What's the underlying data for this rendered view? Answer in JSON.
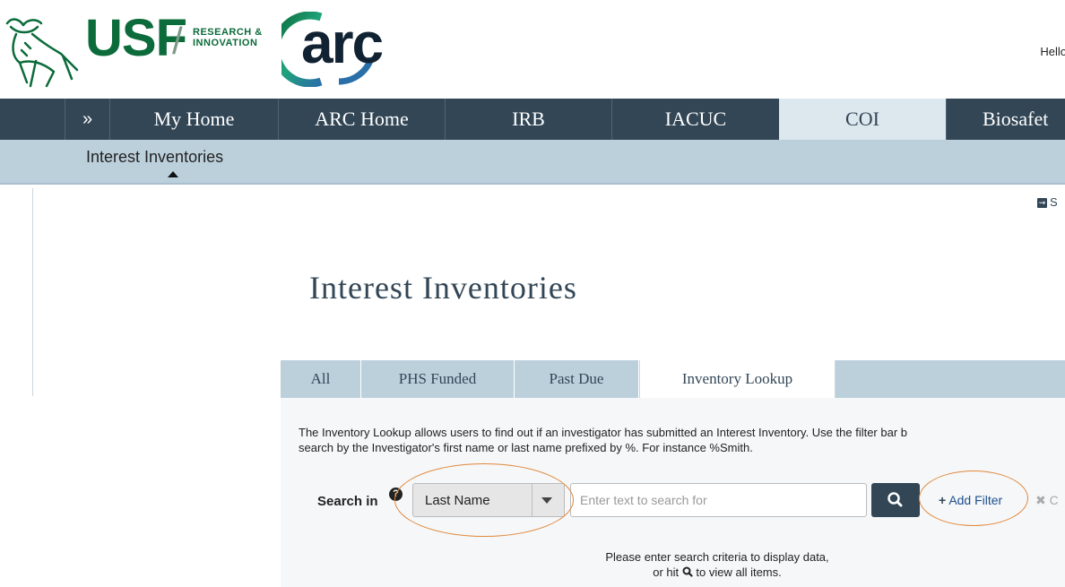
{
  "header": {
    "usf_brand": "USF",
    "usf_subtitle_line1": "RESEARCH &",
    "usf_subtitle_line2": "INNOVATION",
    "arc_brand": "arc",
    "greeting": "Hello"
  },
  "nav": {
    "expand_label": "»",
    "items": [
      "My Home",
      "ARC Home",
      "IRB",
      "IACUC",
      "COI",
      "Biosafet"
    ],
    "active": "COI"
  },
  "subnav": {
    "items": [
      "Interest Inventories"
    ]
  },
  "top_right": {
    "label": "S"
  },
  "page": {
    "title": "Interest Inventories"
  },
  "tabs": [
    {
      "label": "All"
    },
    {
      "label": "PHS Funded"
    },
    {
      "label": "Past Due"
    },
    {
      "label": "Inventory Lookup"
    }
  ],
  "active_tab": "Inventory Lookup",
  "description": {
    "line1": "The Inventory Lookup allows users to find out if an investigator has submitted an Interest Inventory. Use the filter bar b",
    "line2": "search by the Investigator's first name or last name prefixed by %. For instance %Smith."
  },
  "search": {
    "label": "Search in",
    "field_selected": "Last Name",
    "placeholder": "Enter text to search for",
    "add_filter_label": "Add Filter",
    "clear_label": "C"
  },
  "empty_state": {
    "line1": "Please enter search criteria to display data,",
    "line2_prefix": "or hit",
    "line2_suffix": "to view all items."
  },
  "colors": {
    "nav_bg": "#324656",
    "subnav_bg": "#bcd0dc",
    "usf_green": "#0b6b3a",
    "callout": "#e0883a",
    "link": "#1c4f8c"
  }
}
